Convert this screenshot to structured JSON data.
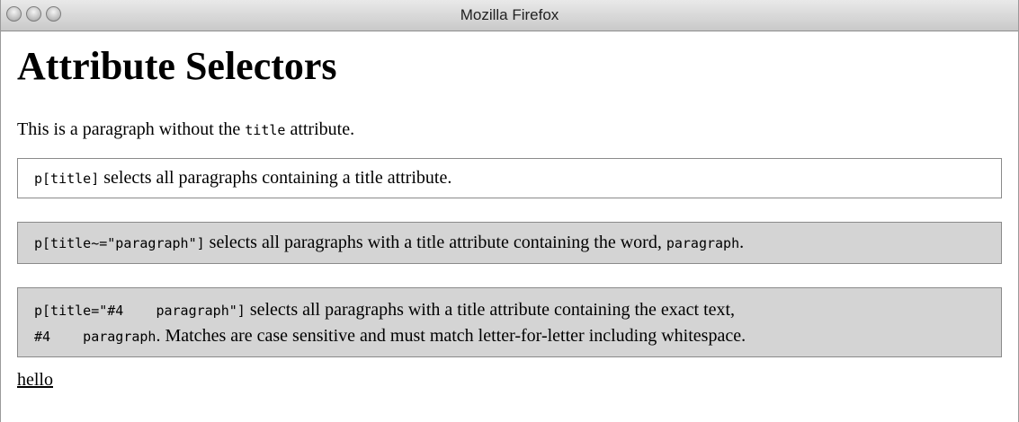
{
  "window": {
    "title": "Mozilla Firefox"
  },
  "page": {
    "heading": "Attribute Selectors",
    "p0": {
      "before": "This is a paragraph without the ",
      "code": "title",
      "after": " attribute."
    },
    "p1": {
      "code": "p[title]",
      "text": " selects all paragraphs containing a title attribute."
    },
    "p2": {
      "code": "p[title~=\"paragraph\"]",
      "text": " selects all paragraphs with a title attribute containing the word, ",
      "code2": "paragraph",
      "after": "."
    },
    "p3": {
      "code": "p[title=\"#4    paragraph\"]",
      "text": " selects all paragraphs with a title attribute containing the exact text,",
      "code2": "#4    paragraph",
      "after": ". Matches are case sensitive and must match letter-for-letter including whitespace."
    },
    "link": "hello"
  }
}
